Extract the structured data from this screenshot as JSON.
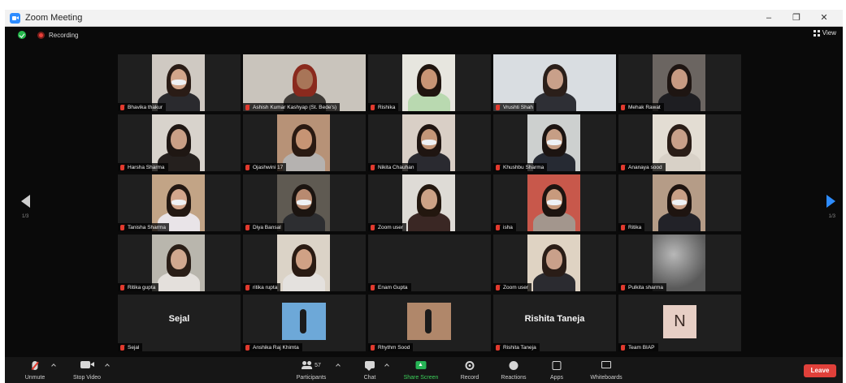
{
  "window": {
    "title": "Zoom Meeting",
    "controls": [
      "–",
      "❐",
      "✕"
    ]
  },
  "status": {
    "recording_label": "Recording",
    "view_label": "View"
  },
  "pages": {
    "left": "1/3",
    "right": "1/3"
  },
  "participants": [
    {
      "name": "Bhavika thakur",
      "video": "center",
      "bg": "#cfc9c2",
      "skin": "#d2a58a",
      "hair": "#2a1c16",
      "shirt": "#2a2a2e",
      "mask": true
    },
    {
      "name": "Ashish Kumar Kashyap (St. Bede's)",
      "video": "wide",
      "bg": "#c9c4bc",
      "skin": "#a87558",
      "hair": "#8a2a1e",
      "shirt": "#3e3a36",
      "mask": false
    },
    {
      "name": "Rishika",
      "video": "center",
      "bg": "#e7e6df",
      "skin": "#c99575",
      "hair": "#20150f",
      "shirt": "#b9d9b0",
      "mask": false
    },
    {
      "name": "Vrushti Shah",
      "video": "wide",
      "bg": "#d9dde1",
      "skin": "#c9a08a",
      "hair": "#2b1f1a",
      "shirt": "#2e2f35",
      "mask": false,
      "active": true
    },
    {
      "name": "Mehak Rawat",
      "video": "center",
      "bg": "#6b6561",
      "skin": "#c79a82",
      "hair": "#1e1512",
      "shirt": "#1e1e22",
      "mask": false
    },
    {
      "name": "Harsha Sharma",
      "video": "center",
      "bg": "#d8d3cc",
      "skin": "#caa086",
      "hair": "#1f1713",
      "shirt": "#25201e",
      "mask": false
    },
    {
      "name": "Ojashwini 17",
      "video": "center",
      "bg": "#b79277",
      "skin": "#c69474",
      "hair": "#2a1a12",
      "shirt": "#b5b2b0",
      "mask": false
    },
    {
      "name": "Nikita Chauhan",
      "video": "center",
      "bg": "#d9cfc6",
      "skin": "#c49678",
      "hair": "#1f1511",
      "shirt": "#2a2a30",
      "mask": true
    },
    {
      "name": "Khushbu Sharma",
      "video": "center",
      "bg": "#cdd0cf",
      "skin": "#c69e85",
      "hair": "#1c1411",
      "shirt": "#262a33",
      "mask": true
    },
    {
      "name": "Ananaya sood",
      "video": "center",
      "bg": "#e3ddd3",
      "skin": "#c9a089",
      "hair": "#2a1d17",
      "shirt": "#d8d1c7",
      "mask": false
    },
    {
      "name": "Tanisha Sharma",
      "video": "center",
      "bg": "#c2a486",
      "skin": "#d3a68c",
      "hair": "#231812",
      "shirt": "#e9e4e8",
      "mask": true
    },
    {
      "name": "Diya Bansal",
      "video": "center",
      "bg": "#5f5a52",
      "skin": "#b88a70",
      "hair": "#1b1410",
      "shirt": "#2d2e31",
      "mask": true
    },
    {
      "name": "Zoom user",
      "video": "center",
      "bg": "#dedbd6",
      "skin": "#cda286",
      "hair": "#23170f",
      "shirt": "#3a2724",
      "mask": false
    },
    {
      "name": "isha",
      "video": "center",
      "bg": "#c8584b",
      "skin": "#c89a7d",
      "hair": "#1d1410",
      "shirt": "#a3968d",
      "mask": true
    },
    {
      "name": "Ritika",
      "video": "center",
      "bg": "#b59c87",
      "skin": "#c99f86",
      "hair": "#1e1410",
      "shirt": "#222228",
      "mask": true
    },
    {
      "name": "Ritika gupta",
      "video": "center",
      "bg": "#b9b6ad",
      "skin": "#d1a88f",
      "hair": "#2a1e17",
      "shirt": "#e4e0dc",
      "mask": false
    },
    {
      "name": "ritika rupta",
      "video": "center",
      "bg": "#dbd3c7",
      "skin": "#d0a185",
      "hair": "#2a1b13",
      "shirt": "#e4e1de",
      "mask": false
    },
    {
      "name": "Enam Gupta",
      "video": "none"
    },
    {
      "name": "Zoom user",
      "video": "center",
      "bg": "#dfd3c3",
      "skin": "#c9a08a",
      "hair": "#2a1d17",
      "shirt": "#2b2b30",
      "mask": false
    },
    {
      "name": "Pulkita sharma",
      "video": "blur",
      "bg": "#8c8c8c"
    },
    {
      "name": "Sejal",
      "video": "text",
      "display": "Sejal"
    },
    {
      "name": "Anshika Raj Khimta",
      "video": "photo",
      "bg": "#6da8d8"
    },
    {
      "name": "Rhythm Sood",
      "video": "photo",
      "bg": "#b0876a"
    },
    {
      "name": "Rishita Taneja",
      "video": "text",
      "display": "Rishita Taneja"
    },
    {
      "name": "Team BIAP",
      "video": "avatar",
      "display": "N"
    }
  ],
  "toolbar": {
    "unmute": "Unmute",
    "stop_video": "Stop Video",
    "participants_count": "57",
    "participants": "Participants",
    "chat": "Chat",
    "share_screen": "Share Screen",
    "record": "Record",
    "reactions": "Reactions",
    "apps": "Apps",
    "whiteboards": "Whiteboards",
    "leave": "Leave"
  }
}
